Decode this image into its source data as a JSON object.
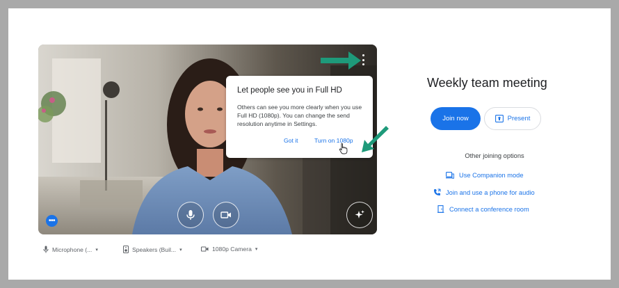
{
  "preview": {
    "popup": {
      "title": "Let people see you in Full HD",
      "body": "Others can see you more clearly when you use Full HD (1080p). You can change the send resolution anytime in Settings.",
      "got_it": "Got it",
      "turn_on": "Turn on 1080p"
    },
    "controls": {
      "microphone_icon": "microphone-icon",
      "camera_icon": "video-camera-icon",
      "effects_icon": "sparkle-icon",
      "more_icon": "more-horizontal-icon",
      "options_icon": "more-vertical-icon"
    }
  },
  "devices": {
    "microphone": "Microphone (...",
    "speakers": "Speakers (Buil...",
    "camera": "1080p Camera"
  },
  "meeting": {
    "title": "Weekly team meeting",
    "join_label": "Join now",
    "present_label": "Present",
    "other_options_label": "Other joining options",
    "options": [
      {
        "label": "Use Companion mode",
        "icon": "companion-mode-icon"
      },
      {
        "label": "Join and use a phone for audio",
        "icon": "phone-icon"
      },
      {
        "label": "Connect a conference room",
        "icon": "room-icon"
      }
    ]
  },
  "colors": {
    "accent": "#1a73e8",
    "annotation_arrow": "#1e9a7a",
    "border": "#a9a9a9"
  }
}
